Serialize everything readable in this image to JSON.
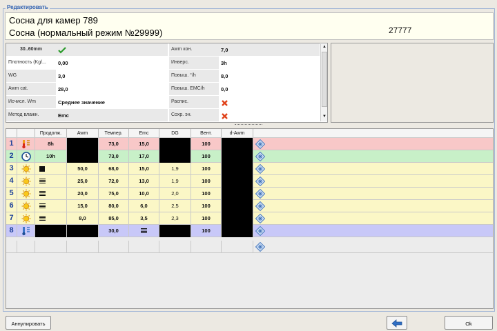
{
  "group_title": "Редактировать",
  "header": {
    "line1": "Сосна для камер 789",
    "line2": "Сосна (нормальный режим №29999)",
    "number": "27777"
  },
  "params_left": [
    {
      "label": "30..60mm",
      "value": "",
      "icon": "checkmark-icon"
    },
    {
      "label": "Плотность (Kg/...",
      "value": "0,00"
    },
    {
      "label": "WG",
      "value": "3,0"
    },
    {
      "label": "Awm cat.",
      "value": "28,0"
    },
    {
      "label": "Исчисл. Wm",
      "value": "Среднее значение"
    },
    {
      "label": "Метод влажн.",
      "value": "Emc"
    }
  ],
  "params_right": [
    {
      "label": "Awm кон.",
      "value": "7,0"
    },
    {
      "label": "Инверс.",
      "value": "3h"
    },
    {
      "label": "Повыш. °/h",
      "value": "8,0"
    },
    {
      "label": "Повыш. EMC/h",
      "value": "0,0"
    },
    {
      "label": "Распис.",
      "value": "",
      "icon": "red-x-icon"
    },
    {
      "label": "Сохр. эн.",
      "value": "",
      "icon": "red-x-icon"
    }
  ],
  "grid": {
    "columns": [
      "",
      "",
      "Продолж.",
      "Awm",
      "Темпер.",
      "Emc",
      "DG",
      "Вент.",
      "d-Awm"
    ],
    "rows": [
      {
        "num": "1",
        "icon": "thermometer-heat-icon",
        "dur": "8h",
        "awm": "",
        "temp": "73,0",
        "emc": "15,0",
        "dg": "",
        "vent": "100",
        "dawm": "",
        "bg": "#f8c8c8"
      },
      {
        "num": "2",
        "icon": "clock-icon",
        "dur": "10h",
        "awm": "",
        "temp": "73,0",
        "emc": "17,0",
        "dg": "",
        "vent": "100",
        "dawm": "",
        "bg": "#c8f0c8"
      },
      {
        "num": "3",
        "icon": "sun-icon",
        "dur": "",
        "awm": "50,0",
        "temp": "68,0",
        "emc": "15,0",
        "dg": "1,9",
        "vent": "100",
        "dawm": "",
        "bg": "#fbf7c6"
      },
      {
        "num": "4",
        "icon": "sun-icon",
        "dur": "",
        "awm": "25,0",
        "temp": "72,0",
        "emc": "13,0",
        "dg": "1,9",
        "vent": "100",
        "dawm": "",
        "bg": "#fbf7c6"
      },
      {
        "num": "5",
        "icon": "sun-icon",
        "dur": "",
        "awm": "20,0",
        "temp": "75,0",
        "emc": "10,0",
        "dg": "2,0",
        "vent": "100",
        "dawm": "",
        "bg": "#fbf7c6"
      },
      {
        "num": "6",
        "icon": "sun-icon",
        "dur": "",
        "awm": "15,0",
        "temp": "80,0",
        "emc": "6,0",
        "dg": "2,5",
        "vent": "100",
        "dawm": "",
        "bg": "#fbf7c6"
      },
      {
        "num": "7",
        "icon": "sun-icon",
        "dur": "",
        "awm": "8,0",
        "temp": "85,0",
        "emc": "3,5",
        "dg": "2,3",
        "vent": "100",
        "dawm": "",
        "bg": "#fbf7c6"
      },
      {
        "num": "8",
        "icon": "thermometer-cool-icon",
        "dur": "",
        "awm": "",
        "temp": "30,0",
        "emc": "",
        "dg": "",
        "vent": "100",
        "dawm": "",
        "bg": "#c8c8f8"
      }
    ]
  },
  "buttons": {
    "cancel": "Аннулировать",
    "ok": "Ok"
  }
}
